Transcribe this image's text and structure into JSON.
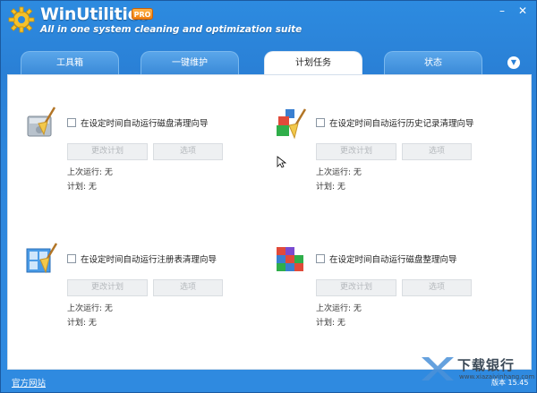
{
  "app": {
    "name": "WinUtilities",
    "badge": "PRO",
    "tagline": "All in one system cleaning and optimization suite",
    "minimize_icon": "minimize-icon",
    "close_icon": "close-icon"
  },
  "tabs": [
    {
      "label": "工具箱",
      "active": false
    },
    {
      "label": "一键维护",
      "active": false
    },
    {
      "label": "计划任务",
      "active": true
    },
    {
      "label": "状态",
      "active": false
    }
  ],
  "tasks": [
    {
      "icon": "disk-cleaner-icon",
      "label": "在设定时间自动运行磁盘清理向导",
      "change_label": "更改计划",
      "options_label": "选项",
      "last_run": "上次运行: 无",
      "plan": "计划: 无"
    },
    {
      "icon": "history-cleaner-icon",
      "label": "在设定时间自动运行历史记录清理向导",
      "change_label": "更改计划",
      "options_label": "选项",
      "last_run": "上次运行: 无",
      "plan": "计划: 无"
    },
    {
      "icon": "registry-cleaner-icon",
      "label": "在设定时间自动运行注册表清理向导",
      "change_label": "更改计划",
      "options_label": "选项",
      "last_run": "上次运行: 无",
      "plan": "计划: 无"
    },
    {
      "icon": "disk-defrag-icon",
      "label": "在设定时间自动运行磁盘整理向导",
      "change_label": "更改计划",
      "options_label": "选项",
      "last_run": "上次运行: 无",
      "plan": "计划: 无"
    }
  ],
  "footer": {
    "website_link": "官方网站",
    "version": "版本 15.45"
  },
  "watermark": {
    "text": "下载银行",
    "url": "www.xiazaiyinhang.com"
  },
  "colors": {
    "frame_blue": "#2d86dc",
    "accent_orange": "#f07f10"
  }
}
